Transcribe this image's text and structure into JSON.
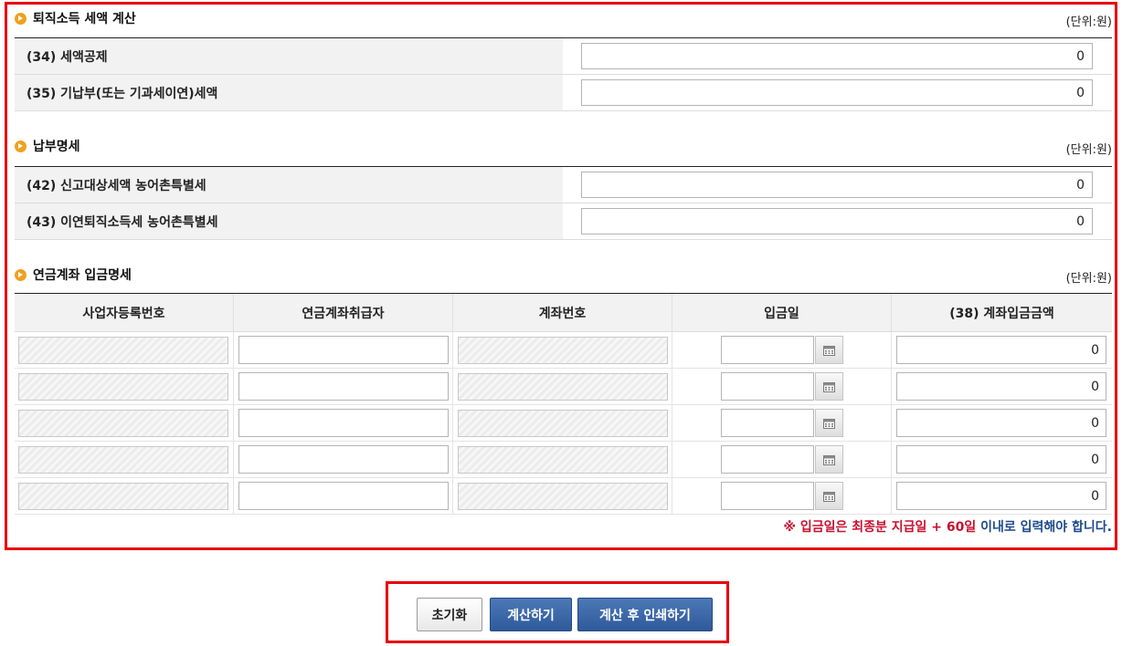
{
  "section1": {
    "title": "퇴직소득 세액 계산",
    "unit": "(단위:원)",
    "rows": [
      {
        "label": "(34) 세액공제",
        "value": "0"
      },
      {
        "label": "(35) 기납부(또는 기과세이연)세액",
        "value": "0"
      }
    ]
  },
  "section2": {
    "title": "납부명세",
    "unit": "(단위:원)",
    "rows": [
      {
        "label": "(42) 신고대상세액 농어촌특별세",
        "value": "0"
      },
      {
        "label": "(43) 이연퇴직소득세 농어촌특별세",
        "value": "0"
      }
    ]
  },
  "section3": {
    "title": "연금계좌 입금명세",
    "unit": "(단위:원)",
    "columns": [
      "사업자등록번호",
      "연금계좌취급자",
      "계좌번호",
      "입금일",
      "(38) 계좌입금금액"
    ],
    "rows": [
      {
        "amount": "0"
      },
      {
        "amount": "0"
      },
      {
        "amount": "0"
      },
      {
        "amount": "0"
      },
      {
        "amount": "0"
      }
    ],
    "notice": {
      "red": "※ 입금일은 최종분 지급일 + 60일",
      "blue": " 이내로 입력해야 합니다."
    }
  },
  "buttons": {
    "reset": "초기화",
    "calc": "계산하기",
    "calc_print": "계산 후 인쇄하기"
  },
  "colors": {
    "highlight_border": "#e8000b",
    "primary_button": "#2f5a9a",
    "notice_red": "#c8102e",
    "notice_blue": "#1d4a8c",
    "bullet": "#f0a020"
  },
  "icons": {
    "section_bullet": "orange-arrow-bullet-icon",
    "date_picker": "calendar-icon"
  }
}
